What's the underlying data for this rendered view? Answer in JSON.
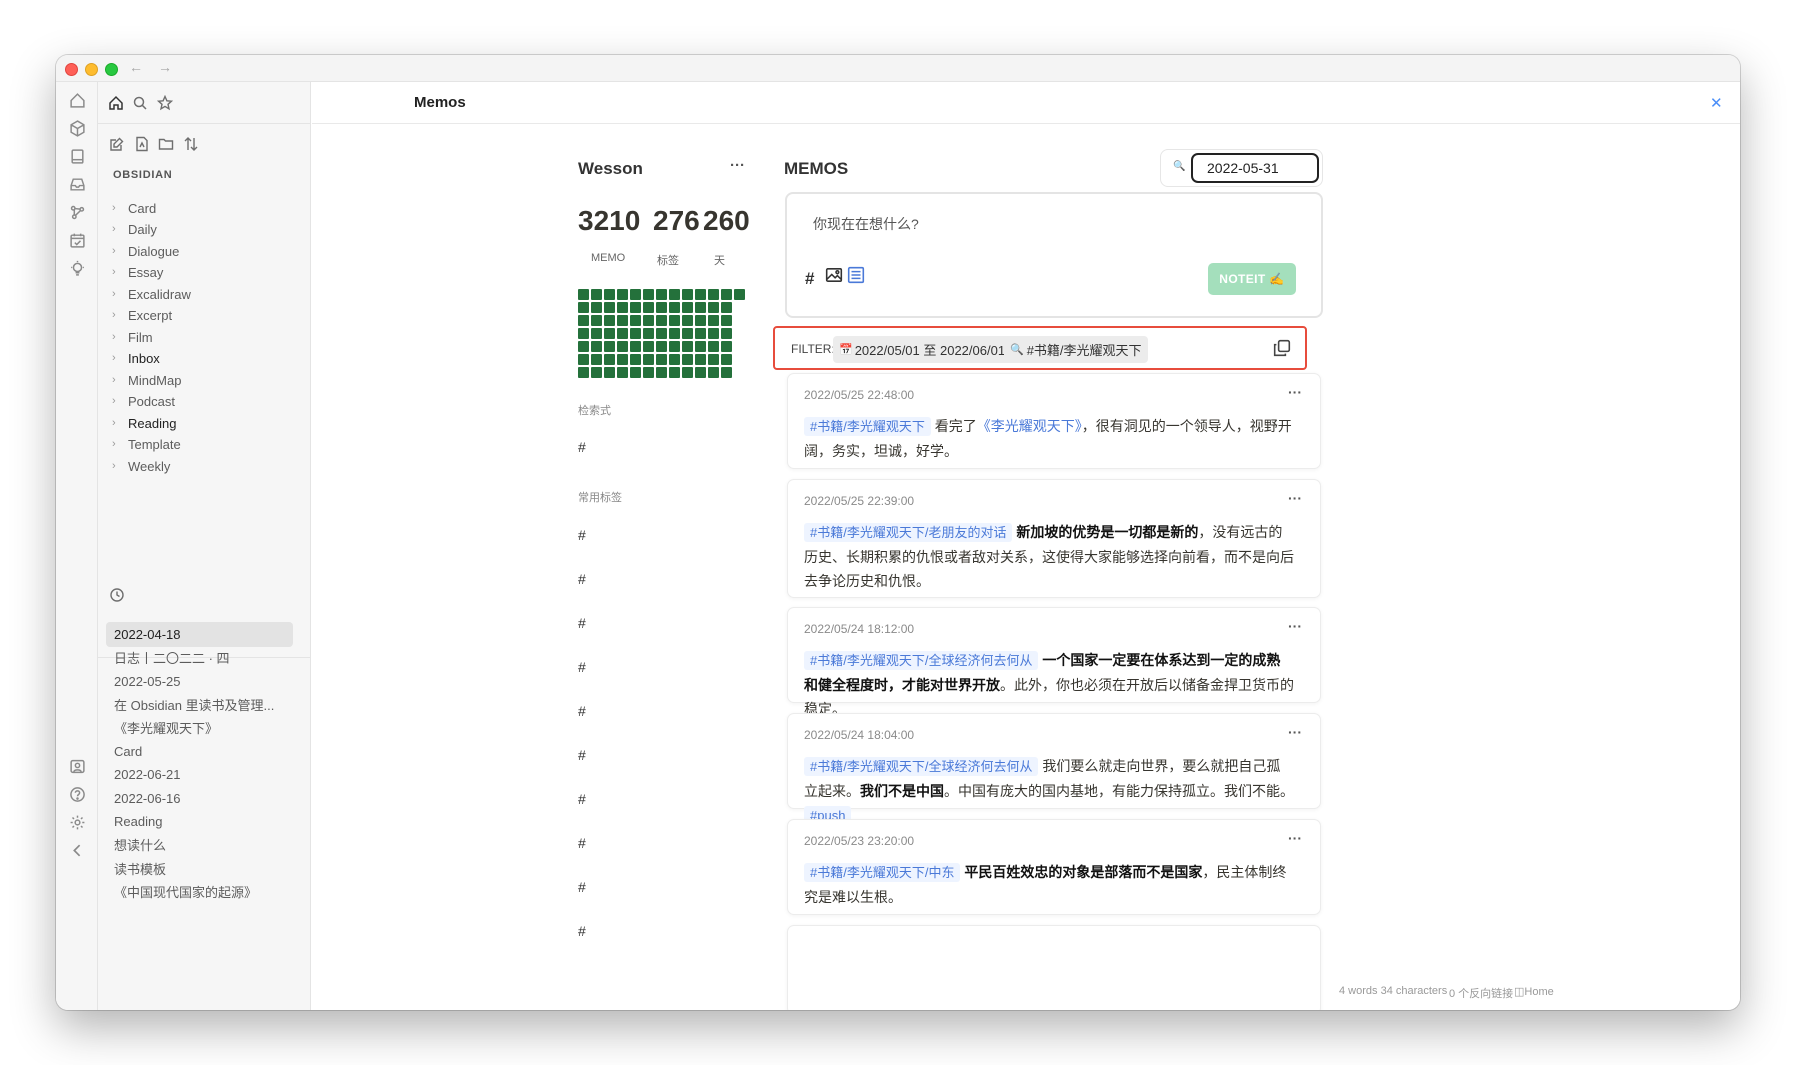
{
  "titlebar": {
    "back": "←",
    "forward": "→"
  },
  "sidebar": {
    "section_label": "OBSIDIAN",
    "folders": [
      "Card",
      "Daily",
      "Dialogue",
      "Essay",
      "Excalidraw",
      "Excerpt",
      "Film",
      "Inbox",
      "MindMap",
      "Podcast",
      "Reading",
      "Template",
      "Weekly"
    ],
    "recent": [
      "2022-04-18",
      "日志丨二〇二二 · 四",
      "2022-05-25",
      "在 Obsidian 里读书及管理...",
      "《李光耀观天下》",
      "Card",
      "2022-06-21",
      "2022-06-16",
      "Reading",
      "想读什么",
      "读书模板",
      "《中国现代国家的起源》"
    ]
  },
  "tab": {
    "title": "Memos",
    "close": "✕",
    "menu": "⋮"
  },
  "user": {
    "name": "Wesson",
    "more": "···"
  },
  "stats": [
    {
      "value": "3210",
      "label": "MEMO"
    },
    {
      "value": "276",
      "label": "标签"
    },
    {
      "value": "260",
      "label": "天"
    }
  ],
  "sections": {
    "query": "检索式",
    "tags": "常用标签",
    "hash": "#"
  },
  "memos_panel": {
    "title": "MEMOS",
    "search_value": "2022-05-31",
    "placeholder": "你现在在想什么?",
    "noteit": "NOTEIT ✍️",
    "filter_label": "FILTER:",
    "filter_date": "2022/05/01 至 2022/06/01",
    "filter_tag": "#书籍/李光耀观天下"
  },
  "memos": [
    {
      "time": "2022/05/25 22:48:00",
      "tag": "#书籍/李光耀观天下",
      "t1": "看完了",
      "link": "《李光耀观天下》",
      "t2": "，很有洞见的一个领导人，视野开阔，务实，坦诚，好学。"
    },
    {
      "time": "2022/05/25 22:39:00",
      "tag": "#书籍/李光耀观天下/老朋友的对话",
      "bold": "新加坡的优势是一切都是新的",
      "t1": "，没有远古的历史、长期积累的仇恨或者敌对关系，这使得大家能够选择向前看，而不是向后去争论历史和仇恨。"
    },
    {
      "time": "2022/05/24 18:12:00",
      "tag": "#书籍/李光耀观天下/全球经济何去何从",
      "bold": "一个国家一定要在体系达到一定的成熟和健全程度时，才能对世界开放",
      "t1": "。此外，你也必须在开放后以储备金捍卫货币的稳定。"
    },
    {
      "time": "2022/05/24 18:04:00",
      "tag": "#书籍/李光耀观天下/全球经济何去何从",
      "t1": "我们要么就走向世界，要么就把自己孤立起来。",
      "bold": "我们不是中国",
      "t2": "。中国有庞大的国内基地，有能力保持孤立。我们不能。",
      "tag2": "#push"
    },
    {
      "time": "2022/05/23 23:20:00",
      "tag": "#书籍/李光耀观天下/中东",
      "bold": "平民百姓效忠的对象是部落而不是国家",
      "t1": "，民主体制终究是难以生根。"
    }
  ],
  "statusbar": {
    "words": "4 words 34 characters",
    "backlinks": "0 个反向链接",
    "home": "Home"
  },
  "colors": {
    "heatmap": "#24713b",
    "filter_border": "#e74c3c",
    "noteit": "#a4dfbc",
    "tag_text": "#4a79d8"
  }
}
